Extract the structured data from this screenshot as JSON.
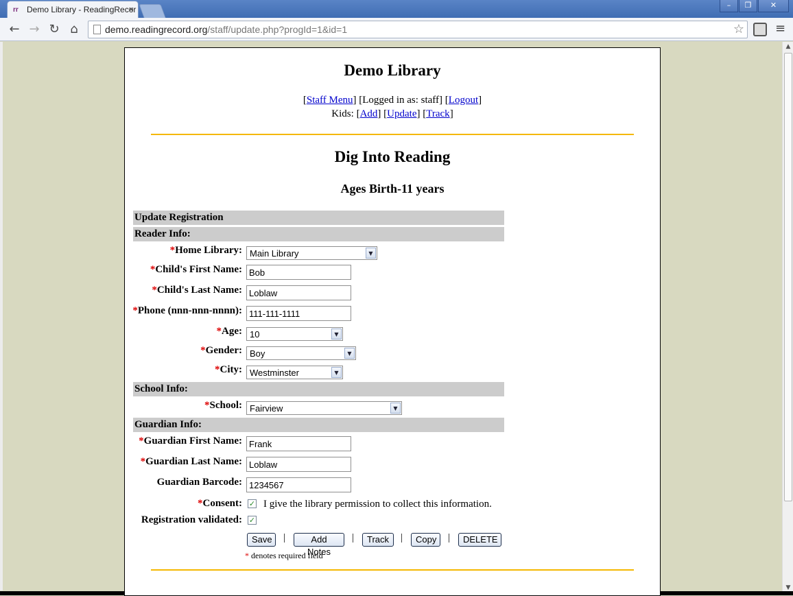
{
  "browser": {
    "tab_title": "Demo Library - ReadingRecor",
    "favicon": "rr",
    "url_host": "demo.readingrecord.org",
    "url_path": "/staff/update.php?progId=1&id=1"
  },
  "header": {
    "library_name": "Demo Library",
    "staff_menu": "Staff Menu",
    "logged_in_text": "[Logged in as: staff]",
    "logout": "Logout",
    "kids_label": "Kids:",
    "add": "Add",
    "update": "Update",
    "track": "Track"
  },
  "program": {
    "name": "Dig Into Reading",
    "ages": "Ages Birth-11 years"
  },
  "form": {
    "sections": {
      "update": "Update Registration",
      "reader": "Reader Info:",
      "school": "School Info:",
      "guardian": "Guardian Info:"
    },
    "fields": {
      "home_library": {
        "label": "Home Library:",
        "value": "Main Library"
      },
      "first_name": {
        "label": "Child's First Name:",
        "value": "Bob"
      },
      "last_name": {
        "label": "Child's Last Name:",
        "value": "Loblaw"
      },
      "phone": {
        "label": "Phone (nnn-nnn-nnnn):",
        "value": "111-111-1111"
      },
      "age": {
        "label": "Age:",
        "value": "10"
      },
      "gender": {
        "label": "Gender:",
        "value": "Boy"
      },
      "city": {
        "label": "City:",
        "value": "Westminster"
      },
      "school": {
        "label": "School:",
        "value": "Fairview"
      },
      "guardian_first": {
        "label": "Guardian First Name:",
        "value": "Frank"
      },
      "guardian_last": {
        "label": "Guardian Last Name:",
        "value": "Loblaw"
      },
      "guardian_barcode": {
        "label": "Guardian Barcode:",
        "value": "1234567"
      },
      "consent": {
        "label": "Consent:",
        "text": "I give the library permission to collect this information.",
        "checked": true
      },
      "validated": {
        "label": "Registration validated:",
        "checked": true
      }
    },
    "buttons": {
      "save": "Save",
      "add_notes": "Add Notes",
      "track": "Track",
      "copy": "Copy",
      "delete": "DELETE"
    },
    "required_star": "*",
    "required_note": "denotes required field"
  },
  "colors": {
    "rule": "#f5b800",
    "section_bg": "#cccccc",
    "required": "#dd0000",
    "link": "#0000cc"
  }
}
